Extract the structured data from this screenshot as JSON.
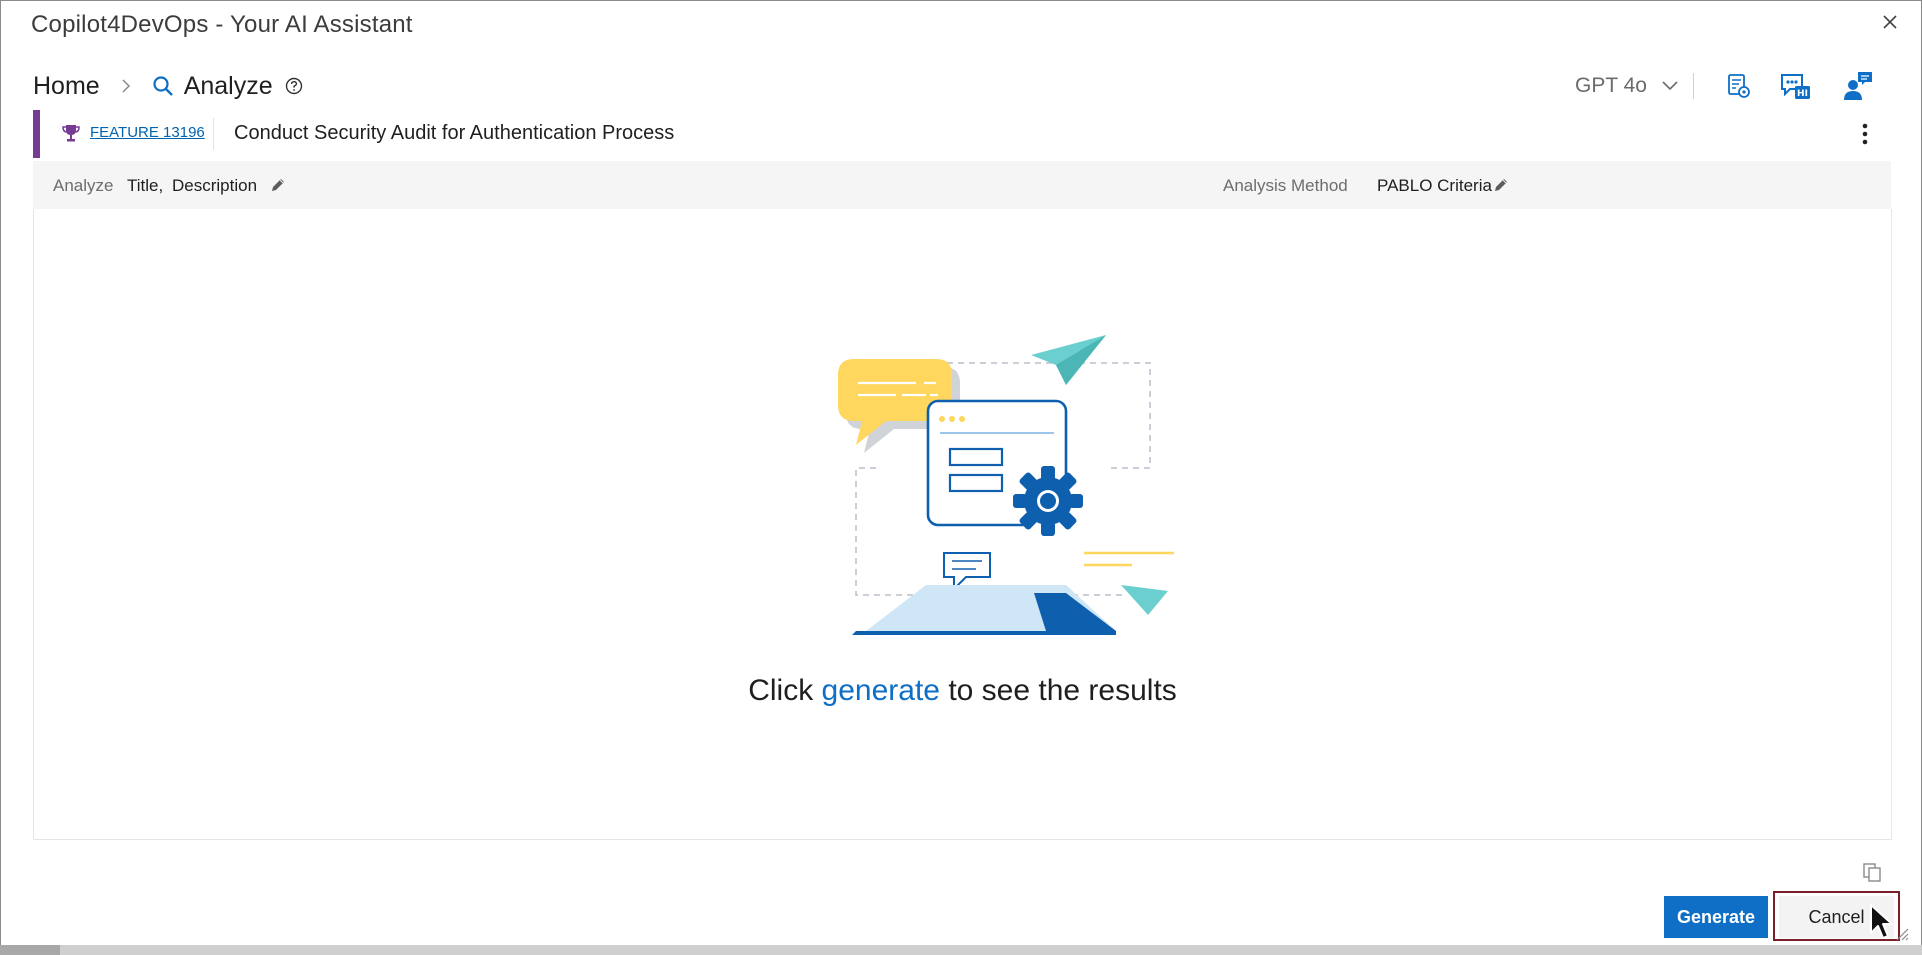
{
  "window": {
    "title": "Copilot4DevOps - Your AI Assistant"
  },
  "breadcrumb": {
    "home": "Home",
    "current": "Analyze"
  },
  "toolbar": {
    "model": "GPT 4o",
    "icons": [
      "settings-document-icon",
      "chat-hi-icon",
      "user-feedback-icon"
    ]
  },
  "work_item": {
    "id": "FEATURE 13196",
    "title": "Conduct Security Audit for Authentication Process",
    "accent_color": "#773b93"
  },
  "options": {
    "analyze_label": "Analyze",
    "analyze_fields": [
      "Title,",
      "Description"
    ],
    "method_label": "Analysis Method",
    "method_value": "PABLO Criteria"
  },
  "empty_state": {
    "before": "Click ",
    "link": "generate",
    "after": " to see the results"
  },
  "footer": {
    "generate_label": "Generate",
    "cancel_label": "Cancel"
  },
  "colors": {
    "primary": "#0f6fc6",
    "cancel_focus": "#7a1e2a"
  }
}
